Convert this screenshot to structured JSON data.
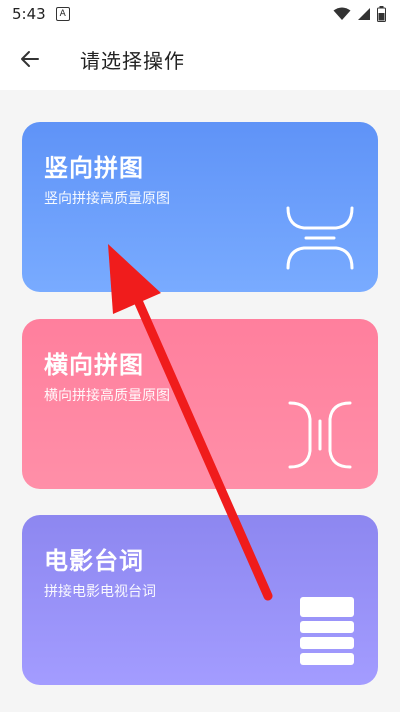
{
  "status_bar": {
    "time": "5:43",
    "app_icon_letter": "A"
  },
  "toolbar": {
    "title": "请选择操作",
    "back_icon": "arrow-left-icon"
  },
  "cards": [
    {
      "title": "竖向拼图",
      "subtitle": "竖向拼接高质量原图",
      "icon": "vertical-stitch-icon",
      "color": "#6a9cfb"
    },
    {
      "title": "横向拼图",
      "subtitle": "横向拼接高质量原图",
      "icon": "horizontal-stitch-icon",
      "color": "#ff87a3"
    },
    {
      "title": "电影台词",
      "subtitle": "拼接电影电视台词",
      "icon": "subtitle-stack-icon",
      "color": "#9a94fb"
    }
  ],
  "annotation": {
    "color": "#f01c1c"
  }
}
